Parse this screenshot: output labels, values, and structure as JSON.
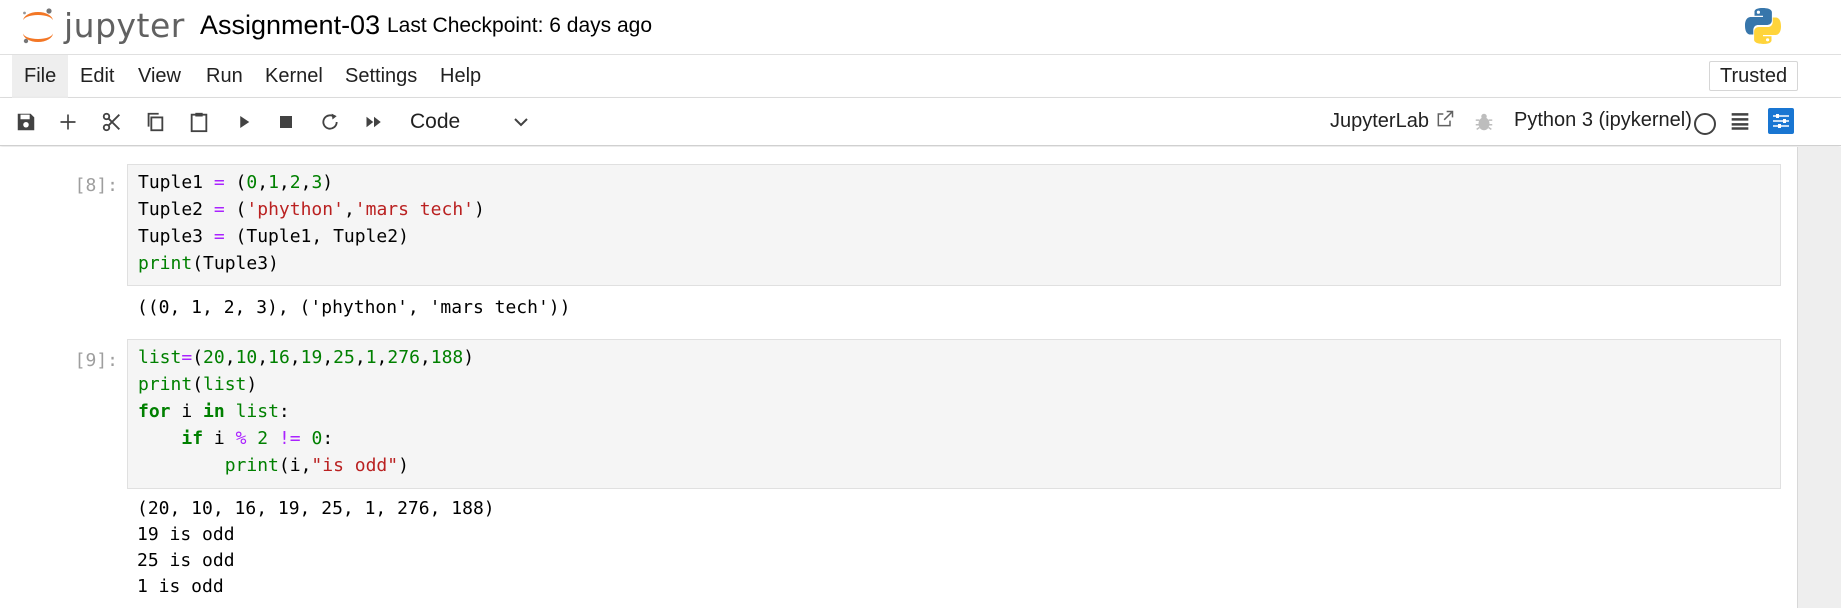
{
  "header": {
    "logo_text": "jupyter",
    "notebook_title": "Assignment-03",
    "checkpoint": "Last Checkpoint: 6 days ago",
    "brand_orange": "#f37726"
  },
  "menubar": {
    "items": [
      "File",
      "Edit",
      "View",
      "Run",
      "Kernel",
      "Settings",
      "Help"
    ],
    "active": "File",
    "trusted_label": "Trusted"
  },
  "toolbar": {
    "icons": [
      "save-icon",
      "add-icon",
      "cut-icon",
      "copy-icon",
      "paste-icon",
      "run-icon",
      "stop-icon",
      "restart-icon",
      "fast-forward-icon"
    ],
    "cell_type": "Code",
    "jupyterlab_label": "JupyterLab",
    "kernel_name": "Python 3 (ipykernel)"
  },
  "cells": [
    {
      "prompt": "[8]:",
      "code": [
        [
          {
            "t": "Tuple1 "
          },
          {
            "t": "=",
            "c": "op"
          },
          {
            "t": " ("
          },
          {
            "t": "0",
            "c": "num"
          },
          {
            "t": ","
          },
          {
            "t": "1",
            "c": "num"
          },
          {
            "t": ","
          },
          {
            "t": "2",
            "c": "num"
          },
          {
            "t": ","
          },
          {
            "t": "3",
            "c": "num"
          },
          {
            "t": ")"
          }
        ],
        [
          {
            "t": "Tuple2 "
          },
          {
            "t": "=",
            "c": "op"
          },
          {
            "t": " ("
          },
          {
            "t": "'phython'",
            "c": "str"
          },
          {
            "t": ","
          },
          {
            "t": "'mars tech'",
            "c": "str"
          },
          {
            "t": ")"
          }
        ],
        [
          {
            "t": "Tuple3 "
          },
          {
            "t": "=",
            "c": "op"
          },
          {
            "t": " (Tuple1, Tuple2)"
          }
        ],
        [
          {
            "t": "print",
            "c": "bi"
          },
          {
            "t": "(Tuple3)"
          }
        ]
      ],
      "output": [
        "((0, 1, 2, 3), ('phython', 'mars tech'))"
      ]
    },
    {
      "prompt": "[9]:",
      "code": [
        [
          {
            "t": "list",
            "c": "bi"
          },
          {
            "t": "=",
            "c": "op"
          },
          {
            "t": "("
          },
          {
            "t": "20",
            "c": "num"
          },
          {
            "t": ","
          },
          {
            "t": "10",
            "c": "num"
          },
          {
            "t": ","
          },
          {
            "t": "16",
            "c": "num"
          },
          {
            "t": ","
          },
          {
            "t": "19",
            "c": "num"
          },
          {
            "t": ","
          },
          {
            "t": "25",
            "c": "num"
          },
          {
            "t": ","
          },
          {
            "t": "1",
            "c": "num"
          },
          {
            "t": ","
          },
          {
            "t": "276",
            "c": "num"
          },
          {
            "t": ","
          },
          {
            "t": "188",
            "c": "num"
          },
          {
            "t": ")"
          }
        ],
        [
          {
            "t": "print",
            "c": "bi"
          },
          {
            "t": "("
          },
          {
            "t": "list",
            "c": "bi"
          },
          {
            "t": ")"
          }
        ],
        [
          {
            "t": "for",
            "c": "kw"
          },
          {
            "t": " i "
          },
          {
            "t": "in",
            "c": "kw"
          },
          {
            "t": " "
          },
          {
            "t": "list",
            "c": "bi"
          },
          {
            "t": ":"
          }
        ],
        [
          {
            "t": "    "
          },
          {
            "t": "if",
            "c": "kw"
          },
          {
            "t": " i "
          },
          {
            "t": "%",
            "c": "op"
          },
          {
            "t": " "
          },
          {
            "t": "2",
            "c": "num"
          },
          {
            "t": " "
          },
          {
            "t": "!=",
            "c": "op"
          },
          {
            "t": " "
          },
          {
            "t": "0",
            "c": "num"
          },
          {
            "t": ":"
          }
        ],
        [
          {
            "t": "        "
          },
          {
            "t": "print",
            "c": "bi"
          },
          {
            "t": "(i,"
          },
          {
            "t": "\"is odd\"",
            "c": "str"
          },
          {
            "t": ")"
          }
        ]
      ],
      "output": [
        "(20, 10, 16, 19, 25, 1, 276, 188)",
        "19 is odd",
        "25 is odd",
        "1 is odd"
      ]
    }
  ]
}
